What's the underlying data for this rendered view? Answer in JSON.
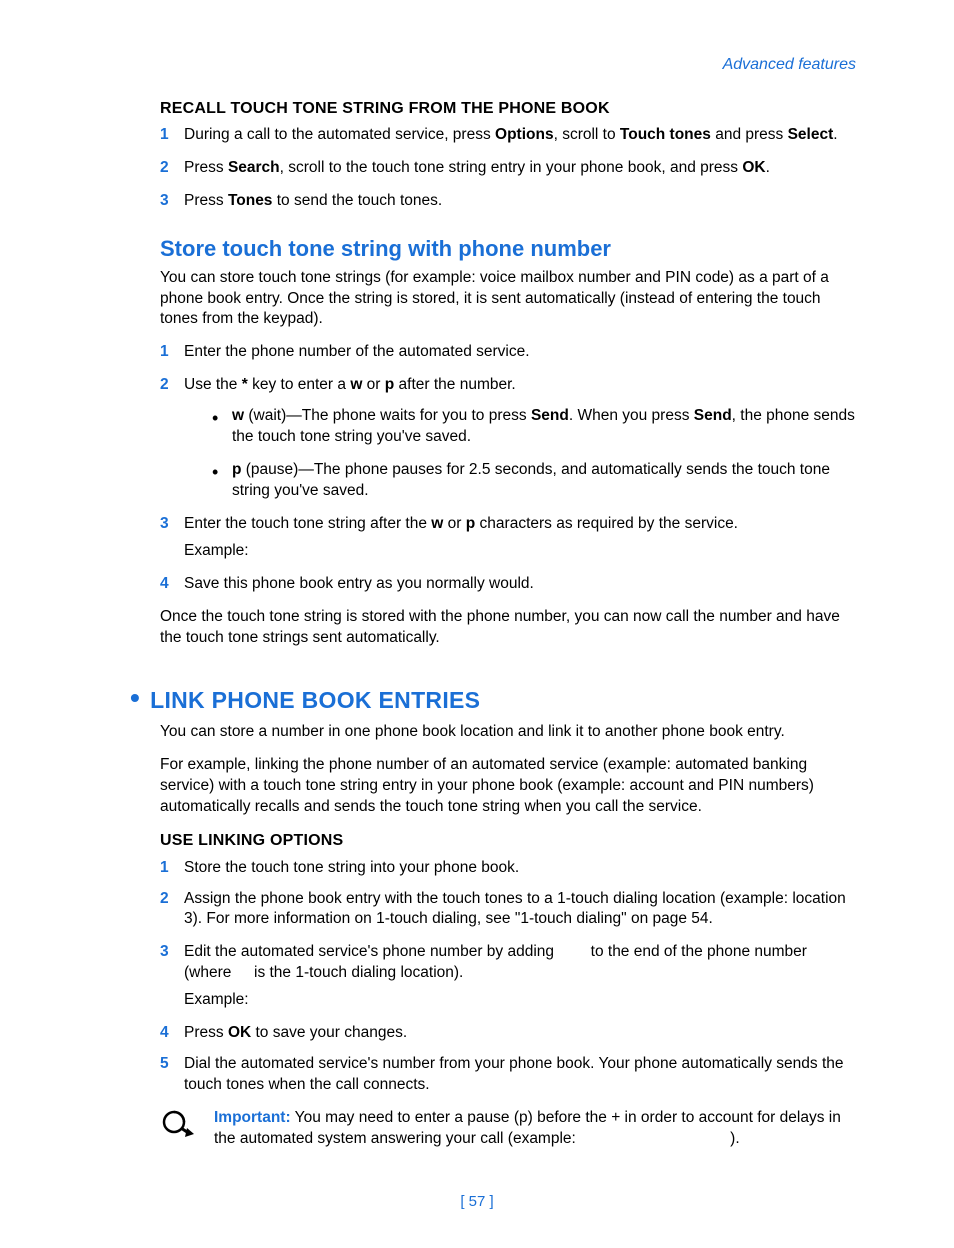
{
  "header": {
    "right": "Advanced features"
  },
  "recall": {
    "heading": "RECALL TOUCH TONE STRING FROM THE PHONE BOOK",
    "steps": [
      {
        "t1": "During a call to the automated service, press ",
        "b1": "Options",
        "t2": ", scroll to ",
        "b2": "Touch tones",
        "t3": " and press ",
        "b3": "Select",
        "t4": "."
      },
      {
        "t1": "Press ",
        "b1": "Search",
        "t2": ", scroll to the touch tone string entry in your phone book, and press ",
        "b2": "OK",
        "t3": "."
      },
      {
        "t1": "Press ",
        "b1": "Tones",
        "t2": " to send the touch tones."
      }
    ]
  },
  "store": {
    "heading": "Store touch tone string with phone number",
    "intro": "You can store touch tone strings (for example: voice mailbox number and PIN code) as a part of a phone book entry. Once the string is stored, it is sent automatically (instead of entering the touch tones from the keypad).",
    "step1": "Enter the phone number of the automated service.",
    "step2": {
      "t1": "Use the ",
      "b1": "*",
      "t2": " key to enter a ",
      "b2": "w",
      "t3": " or ",
      "b3": "p",
      "t4": " after the number."
    },
    "bullet_w": {
      "b1": "w",
      "t1": " (wait)—The phone waits for you to press ",
      "b2": "Send",
      "t2": ". When you press ",
      "b3": "Send",
      "t3": ", the phone sends the touch tone string you've saved."
    },
    "bullet_p": {
      "b1": "p",
      "t1": " (pause)—The phone pauses for 2.5 seconds, and automatically sends the touch tone string you've saved."
    },
    "step3": {
      "t1": "Enter the touch tone string after the ",
      "b1": "w",
      "t2": " or ",
      "b2": "p",
      "t3": " characters as required by the service."
    },
    "example_label": "Example:",
    "step4": "Save this phone book entry as you normally would.",
    "outro": "Once the touch tone string is stored with the phone number, you can now call the number and have the touch tone strings sent automatically."
  },
  "link": {
    "heading": "LINK PHONE BOOK ENTRIES",
    "intro1": "You can store a number in one phone book location and link it to another phone book entry.",
    "intro2": "For example, linking the phone number of an automated service (example: automated banking service) with a touch tone string entry in your phone book (example: account and PIN numbers) automatically recalls and sends the touch tone string when you call the service.",
    "sub_heading": "USE LINKING OPTIONS",
    "step1": "Store the touch tone string into your phone book.",
    "step2": "Assign the phone book entry with the touch tones to a 1-touch dialing location (example: location 3). For more information on 1-touch dialing, see \"1-touch dialing\" on page 54.",
    "step3": {
      "t1": "Edit the automated service's phone number by adding ",
      "t2": " to the end of the phone number (where ",
      "t3": " is the 1-touch dialing location)."
    },
    "example_label": "Example:",
    "step4": {
      "t1": "Press ",
      "b1": "OK",
      "t2": " to save your changes."
    },
    "step5": "Dial the automated service's number from your phone book. Your phone automatically sends the touch tones when the call connects.",
    "important_label": "Important:",
    "important_text": " You may need to enter a pause (p) before the + in order to account for delays in the automated system answering your call (example: ",
    "important_tail": ")."
  },
  "footer": {
    "page": "[ 57 ]"
  }
}
